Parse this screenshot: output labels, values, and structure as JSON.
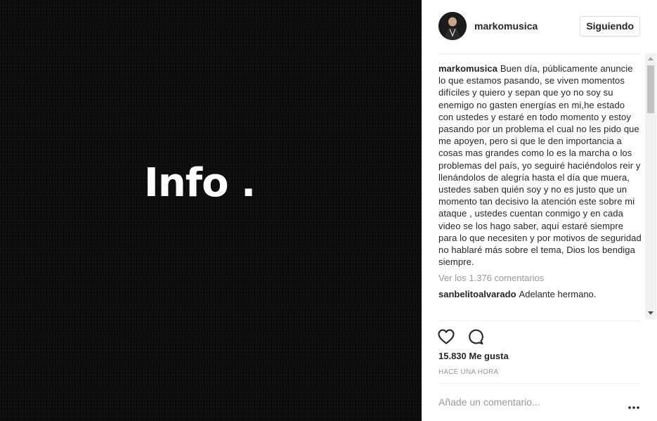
{
  "media": {
    "overlay_text": "Info ."
  },
  "post": {
    "author": "markomusica",
    "follow_label": "Siguiendo",
    "caption": {
      "username": "markomusica",
      "text": "Buen día, públicamente anuncie lo que estamos pasando, se viven momentos difíciles y quiero y sepan que yo no soy su enemigo no gasten energías en mi,he estado con ustedes y estaré en todo momento y estoy pasando por un problema el cual no les pido que me apoyen, pero si que le den importancia a cosas mas grandes como lo es la marcha o los problemas del país, yo seguiré haciéndolos reir y llenándolos de alegría hasta el día que muera, ustedes saben quién soy y no es justo que un momento tan decisivo la atención este sobre mi ataque , ustedes cuentan conmigo y en cada video se los hago saber, aquí estaré siempre para lo que necesiten y por motivos de seguridad no hablaré más sobre el tema, Dios los bendiga siempre."
    },
    "view_all_comments": "Ver los 1.376 comentarios",
    "comments": [
      {
        "username": "sanbelitoalvarado",
        "text": "Adelante hermano."
      }
    ],
    "likes": "15.830 Me gusta",
    "timestamp": "HACE UNA HORA",
    "comment_placeholder": "Añade un comentario..."
  },
  "icons": {
    "like": "heart-icon",
    "comment": "speech-bubble-icon",
    "options": "more-options-icon"
  },
  "colors": {
    "text_primary": "#262626",
    "text_secondary": "#999999",
    "divider": "#efefef",
    "media_background": "#0b0b0b"
  }
}
